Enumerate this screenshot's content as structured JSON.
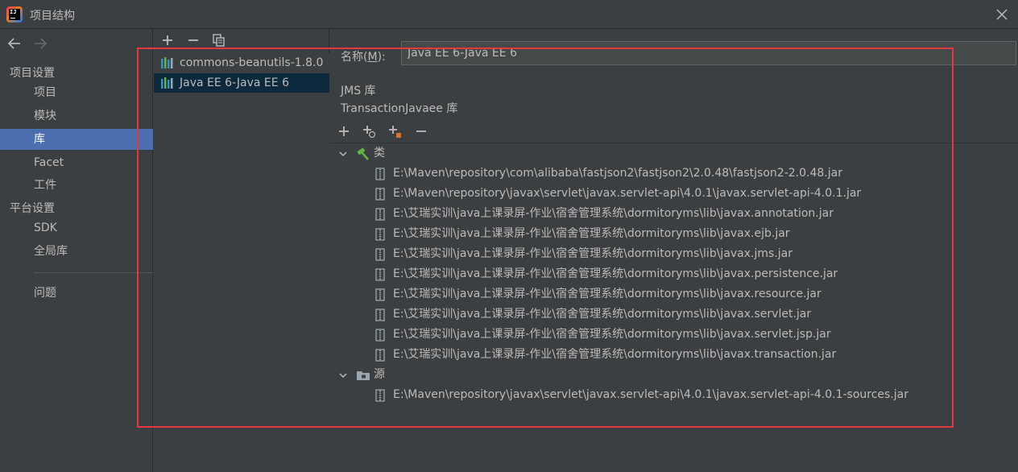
{
  "window": {
    "title": "项目结构"
  },
  "nav": {
    "sections": [
      {
        "label": "项目设置"
      },
      {
        "label": "平台设置"
      }
    ],
    "items": [
      {
        "label": "项目"
      },
      {
        "label": "模块"
      },
      {
        "label": "库"
      },
      {
        "label": "Facet"
      },
      {
        "label": "工件"
      },
      {
        "label": "SDK"
      },
      {
        "label": "全局库"
      },
      {
        "label": "问题"
      }
    ],
    "selected": "库"
  },
  "libraries": {
    "items": [
      {
        "label": "commons-beanutils-1.8.0"
      },
      {
        "label": "Java EE 6-Java EE 6"
      }
    ],
    "selected": "Java EE 6-Java EE 6"
  },
  "detail": {
    "name_label": "名称",
    "name_mnemonic": "M",
    "name_value": "Java EE 6-Java EE 6",
    "info_lines": [
      "JMS 库",
      "TransactionJavaee 库"
    ],
    "classes_label": "类",
    "classes": [
      "E:\\Maven\\repository\\com\\alibaba\\fastjson2\\fastjson2\\2.0.48\\fastjson2-2.0.48.jar",
      "E:\\Maven\\repository\\javax\\servlet\\javax.servlet-api\\4.0.1\\javax.servlet-api-4.0.1.jar",
      "E:\\艾瑞实训\\java上课录屏-作业\\宿舍管理系统\\dormitoryms\\lib\\javax.annotation.jar",
      "E:\\艾瑞实训\\java上课录屏-作业\\宿舍管理系统\\dormitoryms\\lib\\javax.ejb.jar",
      "E:\\艾瑞实训\\java上课录屏-作业\\宿舍管理系统\\dormitoryms\\lib\\javax.jms.jar",
      "E:\\艾瑞实训\\java上课录屏-作业\\宿舍管理系统\\dormitoryms\\lib\\javax.persistence.jar",
      "E:\\艾瑞实训\\java上课录屏-作业\\宿舍管理系统\\dormitoryms\\lib\\javax.resource.jar",
      "E:\\艾瑞实训\\java上课录屏-作业\\宿舍管理系统\\dormitoryms\\lib\\javax.servlet.jar",
      "E:\\艾瑞实训\\java上课录屏-作业\\宿舍管理系统\\dormitoryms\\lib\\javax.servlet.jsp.jar",
      "E:\\艾瑞实训\\java上课录屏-作业\\宿舍管理系统\\dormitoryms\\lib\\javax.transaction.jar"
    ],
    "sources_label": "源",
    "sources": [
      "E:\\Maven\\repository\\javax\\servlet\\javax.servlet-api\\4.0.1\\javax.servlet-api-4.0.1-sources.jar"
    ]
  },
  "colors": {
    "nav_selected": "#4b6eaf",
    "list_selected": "#0d293e",
    "highlight_box": "#e0393e",
    "background": "#3c3f41"
  },
  "icons": {
    "close": "close-icon",
    "back": "arrow-left-icon",
    "forward": "arrow-right-icon",
    "add": "plus-icon",
    "remove": "minus-icon",
    "copy": "copy-icon",
    "library": "library-icon",
    "jar": "jar-icon",
    "classes_folder": "hammer-icon",
    "sources_folder": "source-folder-icon",
    "expand": "chevron-down-icon"
  }
}
